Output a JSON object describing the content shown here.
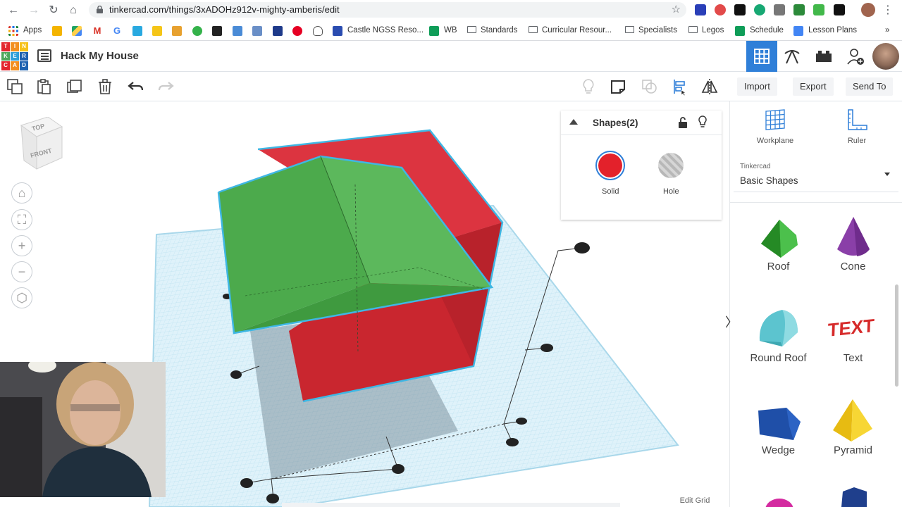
{
  "browser": {
    "url": "tinkercad.com/things/3xADOHz912v-mighty-amberis/edit",
    "bookmarks": {
      "apps": "Apps",
      "castle": "Castle NGSS Reso...",
      "wb": "WB",
      "standards": "Standards",
      "curricular": "Curricular Resour...",
      "specialists": "Specialists",
      "legos": "Legos",
      "schedule": "Schedule",
      "lesson_plans": "Lesson Plans",
      "more": "»"
    }
  },
  "app": {
    "logo_letters": [
      "T",
      "I",
      "N",
      "K",
      "E",
      "R",
      "C",
      "A",
      "D"
    ],
    "logo_colors": [
      "#e3262e",
      "#f38f1f",
      "#f6c21b",
      "#4fa85c",
      "#2f9fd8",
      "#1e62b0",
      "#e3262e",
      "#f38f1f",
      "#1e62b0"
    ],
    "design_title": "Hack My House",
    "accent": "#2f7fd8"
  },
  "toolbar": {
    "import": "Import",
    "export": "Export",
    "send_to": "Send To"
  },
  "view_cube": {
    "top": "TOP",
    "front": "FRONT"
  },
  "inspector": {
    "title": "Shapes(2)",
    "solid": "Solid",
    "hole": "Hole",
    "solid_color": "#e3212b"
  },
  "right_panel": {
    "workplane": "Workplane",
    "ruler": "Ruler",
    "library_source": "Tinkercad",
    "library_name": "Basic Shapes",
    "shapes": [
      {
        "label": "Roof",
        "icon": "roof-icon",
        "color": "#3aa63a"
      },
      {
        "label": "Cone",
        "icon": "cone-icon",
        "color": "#8a3fa8"
      },
      {
        "label": "Round Roof",
        "icon": "round-roof-icon",
        "color": "#5cc4cf"
      },
      {
        "label": "Text",
        "icon": "text-icon",
        "color": "#d62a2a"
      },
      {
        "label": "Wedge",
        "icon": "wedge-icon",
        "color": "#1f4fa8"
      },
      {
        "label": "Pyramid",
        "icon": "pyramid-icon",
        "color": "#f0c91c"
      }
    ]
  },
  "scene": {
    "roof_color": "#5cb85c",
    "box_color": "#dc3440",
    "grid_color": "#9fd4ea"
  },
  "edit_grid": "Edit Grid",
  "panel_toggle": "〉"
}
